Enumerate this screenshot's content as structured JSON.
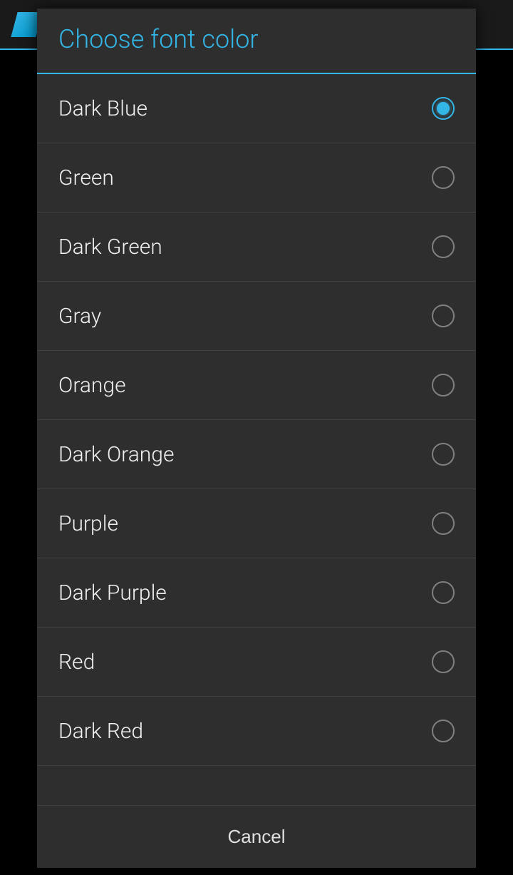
{
  "dialog": {
    "title": "Choose font color",
    "cancel_label": "Cancel",
    "selected_index": 0,
    "options": [
      {
        "label": "Dark Blue"
      },
      {
        "label": "Green"
      },
      {
        "label": "Dark Green"
      },
      {
        "label": "Gray"
      },
      {
        "label": "Orange"
      },
      {
        "label": "Dark Orange"
      },
      {
        "label": "Purple"
      },
      {
        "label": "Dark Purple"
      },
      {
        "label": "Red"
      },
      {
        "label": "Dark Red"
      }
    ]
  },
  "colors": {
    "accent": "#33b5e5"
  }
}
